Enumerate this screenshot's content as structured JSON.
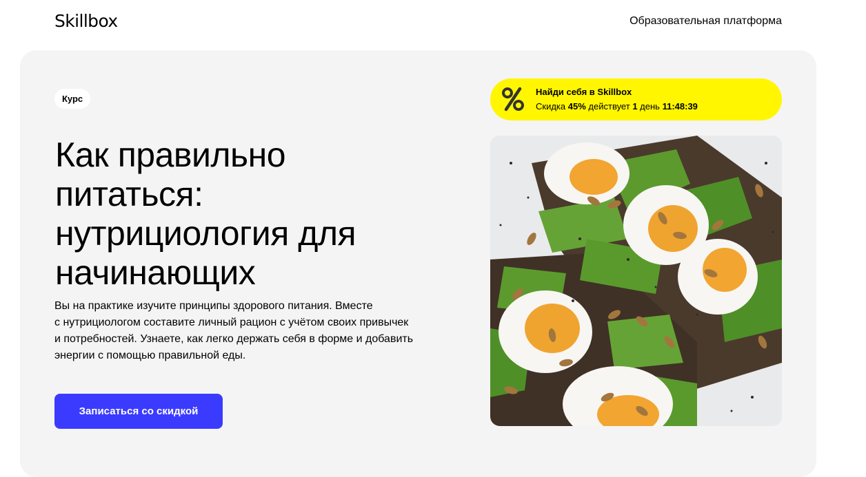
{
  "header": {
    "logo": "Skillbox",
    "platform_link": "Образовательная платформа"
  },
  "hero": {
    "badge": "Курс",
    "title_lines": [
      "Как правильно",
      "питаться:",
      "нутрициология для",
      "начинающих"
    ],
    "description_lines": [
      "Вы на практике изучите принципы здорового питания. Вместе",
      "с нутрициологом составите личный рацион с учётом своих привычек",
      "и потребностей. Узнаете, как легко держать себя в форме и добавить",
      "энергии с помощью правильной еды."
    ],
    "cta_label": "Записаться со скидкой"
  },
  "promo": {
    "icon": "percent-icon",
    "title": "Найди себя в Skillbox",
    "discount_prefix": "Скидка",
    "discount_value": "45%",
    "discount_middle": "действует",
    "days_value": "1",
    "days_label": "день",
    "timer": "11:48:39",
    "color": "#fff600"
  },
  "colors": {
    "accent": "#3b3bff",
    "hero_bg": "#f4f4f4",
    "promo_bg": "#fff600"
  },
  "image": {
    "icon": "food-photo"
  }
}
